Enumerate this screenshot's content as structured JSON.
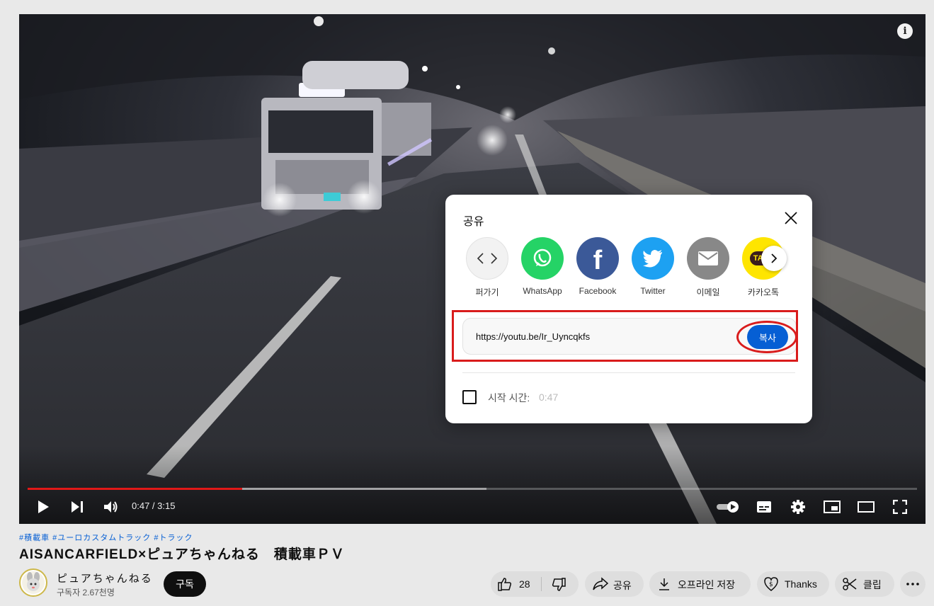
{
  "player": {
    "current_time": "0:47",
    "duration": "3:15",
    "time_display": "0:47 / 3:15",
    "progress_played_fraction": 0.241,
    "progress_buffered_fraction": 0.516
  },
  "share_dialog": {
    "title": "공유",
    "targets": [
      {
        "label": "퍼가기",
        "icon": "embed-icon",
        "color": "#f2f2f2"
      },
      {
        "label": "WhatsApp",
        "icon": "whatsapp-icon",
        "color": "#25d366"
      },
      {
        "label": "Facebook",
        "icon": "facebook-icon",
        "color": "#3b5998"
      },
      {
        "label": "Twitter",
        "icon": "twitter-icon",
        "color": "#1da1f2"
      },
      {
        "label": "이메일",
        "icon": "email-icon",
        "color": "#888888"
      },
      {
        "label": "카카오톡",
        "icon": "kakaotalk-icon",
        "color": "#fee500"
      }
    ],
    "kakao_badge": "TALK",
    "link_url": "https://youtu.be/Ir_Uyncqkfs",
    "copy_label": "복사",
    "start_time_label": "시작 시간:",
    "start_time_value": "0:47",
    "highlight_color": "#d91c1c"
  },
  "video_info": {
    "hashtags": "#積載車 #ユーロカスタムトラック #トラック",
    "title": "AISANCARFIELD×ピュアちゃんねる　積載車ＰＶ",
    "channel_name": "ピュアちゃんねる",
    "subscribers": "구독자 2.67천명",
    "subscribe_label": "구독"
  },
  "actions": {
    "like_count": "28",
    "share_label": "공유",
    "download_label": "오프라인 저장",
    "thanks_label": "Thanks",
    "clip_label": "클립"
  },
  "colors": {
    "accent_blue": "#065fd4",
    "progress_red": "#e01818"
  }
}
